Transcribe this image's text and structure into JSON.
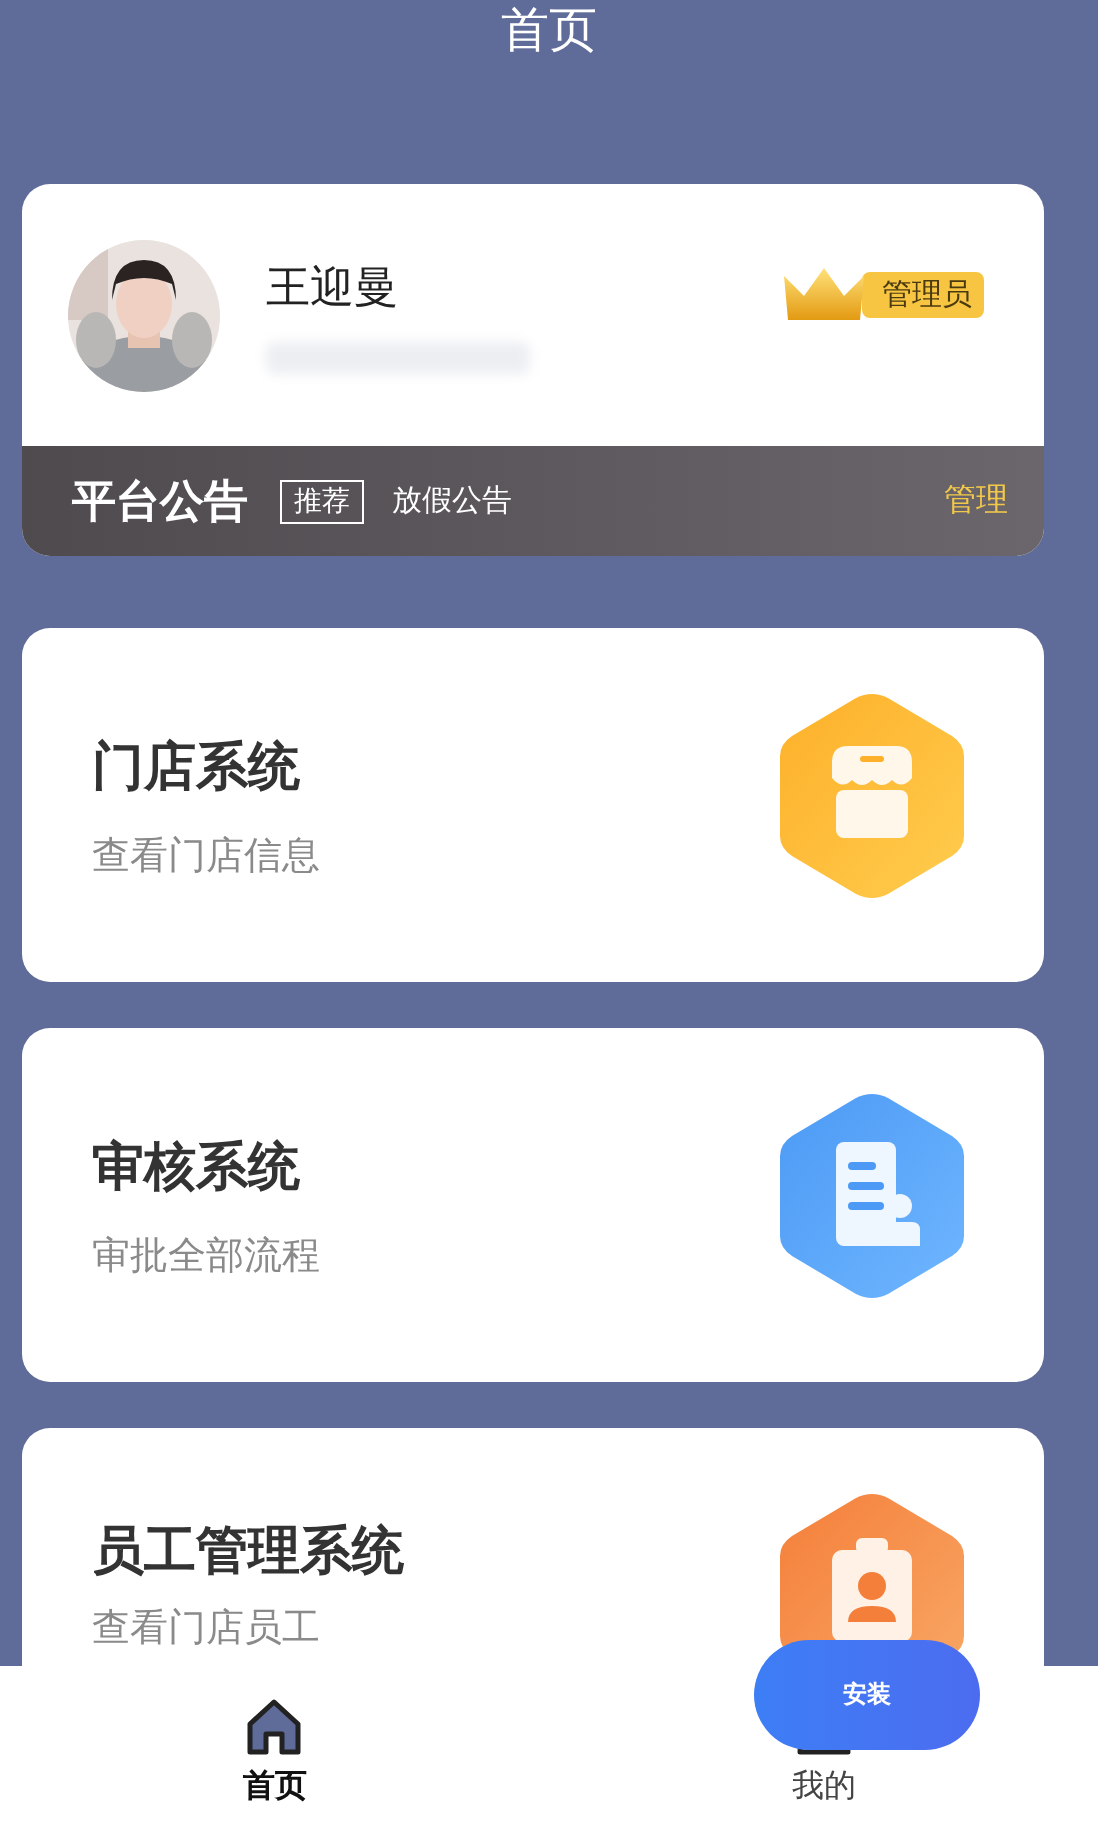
{
  "header": {
    "title": "首页"
  },
  "profile": {
    "name": "王迎曼",
    "role": "管理员"
  },
  "notice": {
    "title": "平台公告",
    "tag": "推荐",
    "text": "放假公告",
    "action": "管理"
  },
  "systems": [
    {
      "title": "门店系统",
      "subtitle": "查看门店信息",
      "kind": "store"
    },
    {
      "title": "审核系统",
      "subtitle": "审批全部流程",
      "kind": "audit"
    },
    {
      "title": "员工管理系统",
      "subtitle": "查看门店员工",
      "kind": "staff"
    }
  ],
  "tabs": [
    {
      "label": "首页",
      "kind": "home",
      "selected": true
    },
    {
      "label": "我的",
      "kind": "user",
      "selected": false
    }
  ],
  "install_button": {
    "label": "安装"
  }
}
